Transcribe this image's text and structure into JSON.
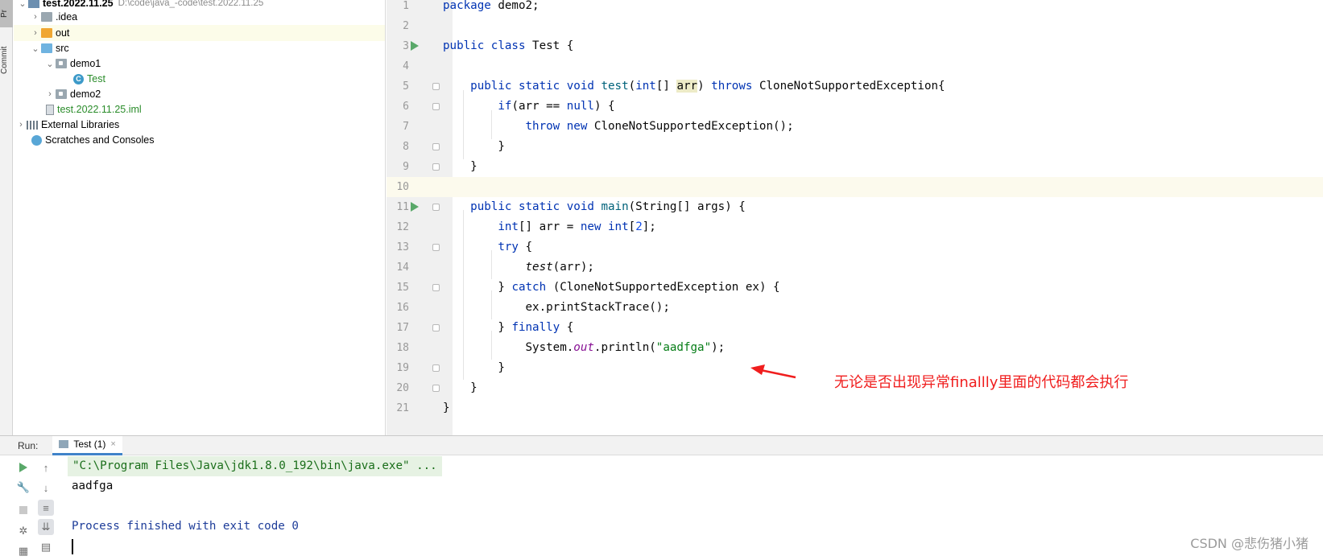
{
  "toolstrip": {
    "project_tab": "Pr",
    "commit_tab": "Commit"
  },
  "tree": {
    "root": {
      "name": "test.2022.11.25",
      "path": "D:\\code\\java_-code\\test.2022.11.25"
    },
    "idea": ".idea",
    "out": "out",
    "src": "src",
    "demo1": "demo1",
    "test_class": "Test",
    "demo2": "demo2",
    "iml": "test.2022.11.25.iml",
    "external_libraries": "External Libraries",
    "scratches": "Scratches and Consoles"
  },
  "editor": {
    "line_numbers": [
      "1",
      "2",
      "3",
      "4",
      "5",
      "6",
      "7",
      "8",
      "9",
      "10",
      "11",
      "12",
      "13",
      "14",
      "15",
      "16",
      "17",
      "18",
      "19",
      "20",
      "21"
    ],
    "l1_kw": "package",
    "l1_rest": " demo2;",
    "l3_kw": "public class",
    "l3_rest": " Test {",
    "l5_kw1": "public static void",
    "l5_fn": " test",
    "l5_p1": "(",
    "l5_kw2": "int",
    "l5_p2": "[] ",
    "l5_arr": "arr",
    "l5_p3": ") ",
    "l5_kw3": "throws",
    "l5_p4": " CloneNotSupportedException{",
    "l6_kw": "if",
    "l6_p1": "(arr == ",
    "l6_kw2": "null",
    "l6_p2": ") {",
    "l7_kw": "throw new",
    "l7_rest": " CloneNotSupportedException();",
    "l8": "}",
    "l9": "}",
    "l11_kw1": "public static void",
    "l11_fn": " main",
    "l11_rest": "(String[] args) {",
    "l12_kw1": "int",
    "l12_p1": "[] arr = ",
    "l12_kw2": "new int",
    "l12_p2": "[",
    "l12_num": "2",
    "l12_p3": "];",
    "l13_kw": "try",
    "l13_rest": " {",
    "l14_call": "test",
    "l14_rest": "(arr);",
    "l15_p1": "} ",
    "l15_kw": "catch",
    "l15_rest": " (CloneNotSupportedException ex) {",
    "l16": "ex.printStackTrace();",
    "l17_p1": "} ",
    "l17_kw": "finally",
    "l17_rest": " {",
    "l18_p1": "System.",
    "l18_out": "out",
    "l18_p2": ".println(",
    "l18_str": "\"aadfga\"",
    "l18_p3": ");",
    "l19": "}",
    "l20": "}",
    "l21": "}"
  },
  "annotation": {
    "text": "无论是否出现异常finallly里面的代码都会执行",
    "color": "#f01e1e"
  },
  "run": {
    "label": "Run:",
    "tab": "Test (1)",
    "tab_close": "×",
    "cmd": "\"C:\\Program Files\\Java\\jdk1.8.0_192\\bin\\java.exe\" ...",
    "output": "aadfga",
    "exit": "Process finished with exit code 0"
  },
  "watermark": "CSDN @悲伤猪小猪"
}
